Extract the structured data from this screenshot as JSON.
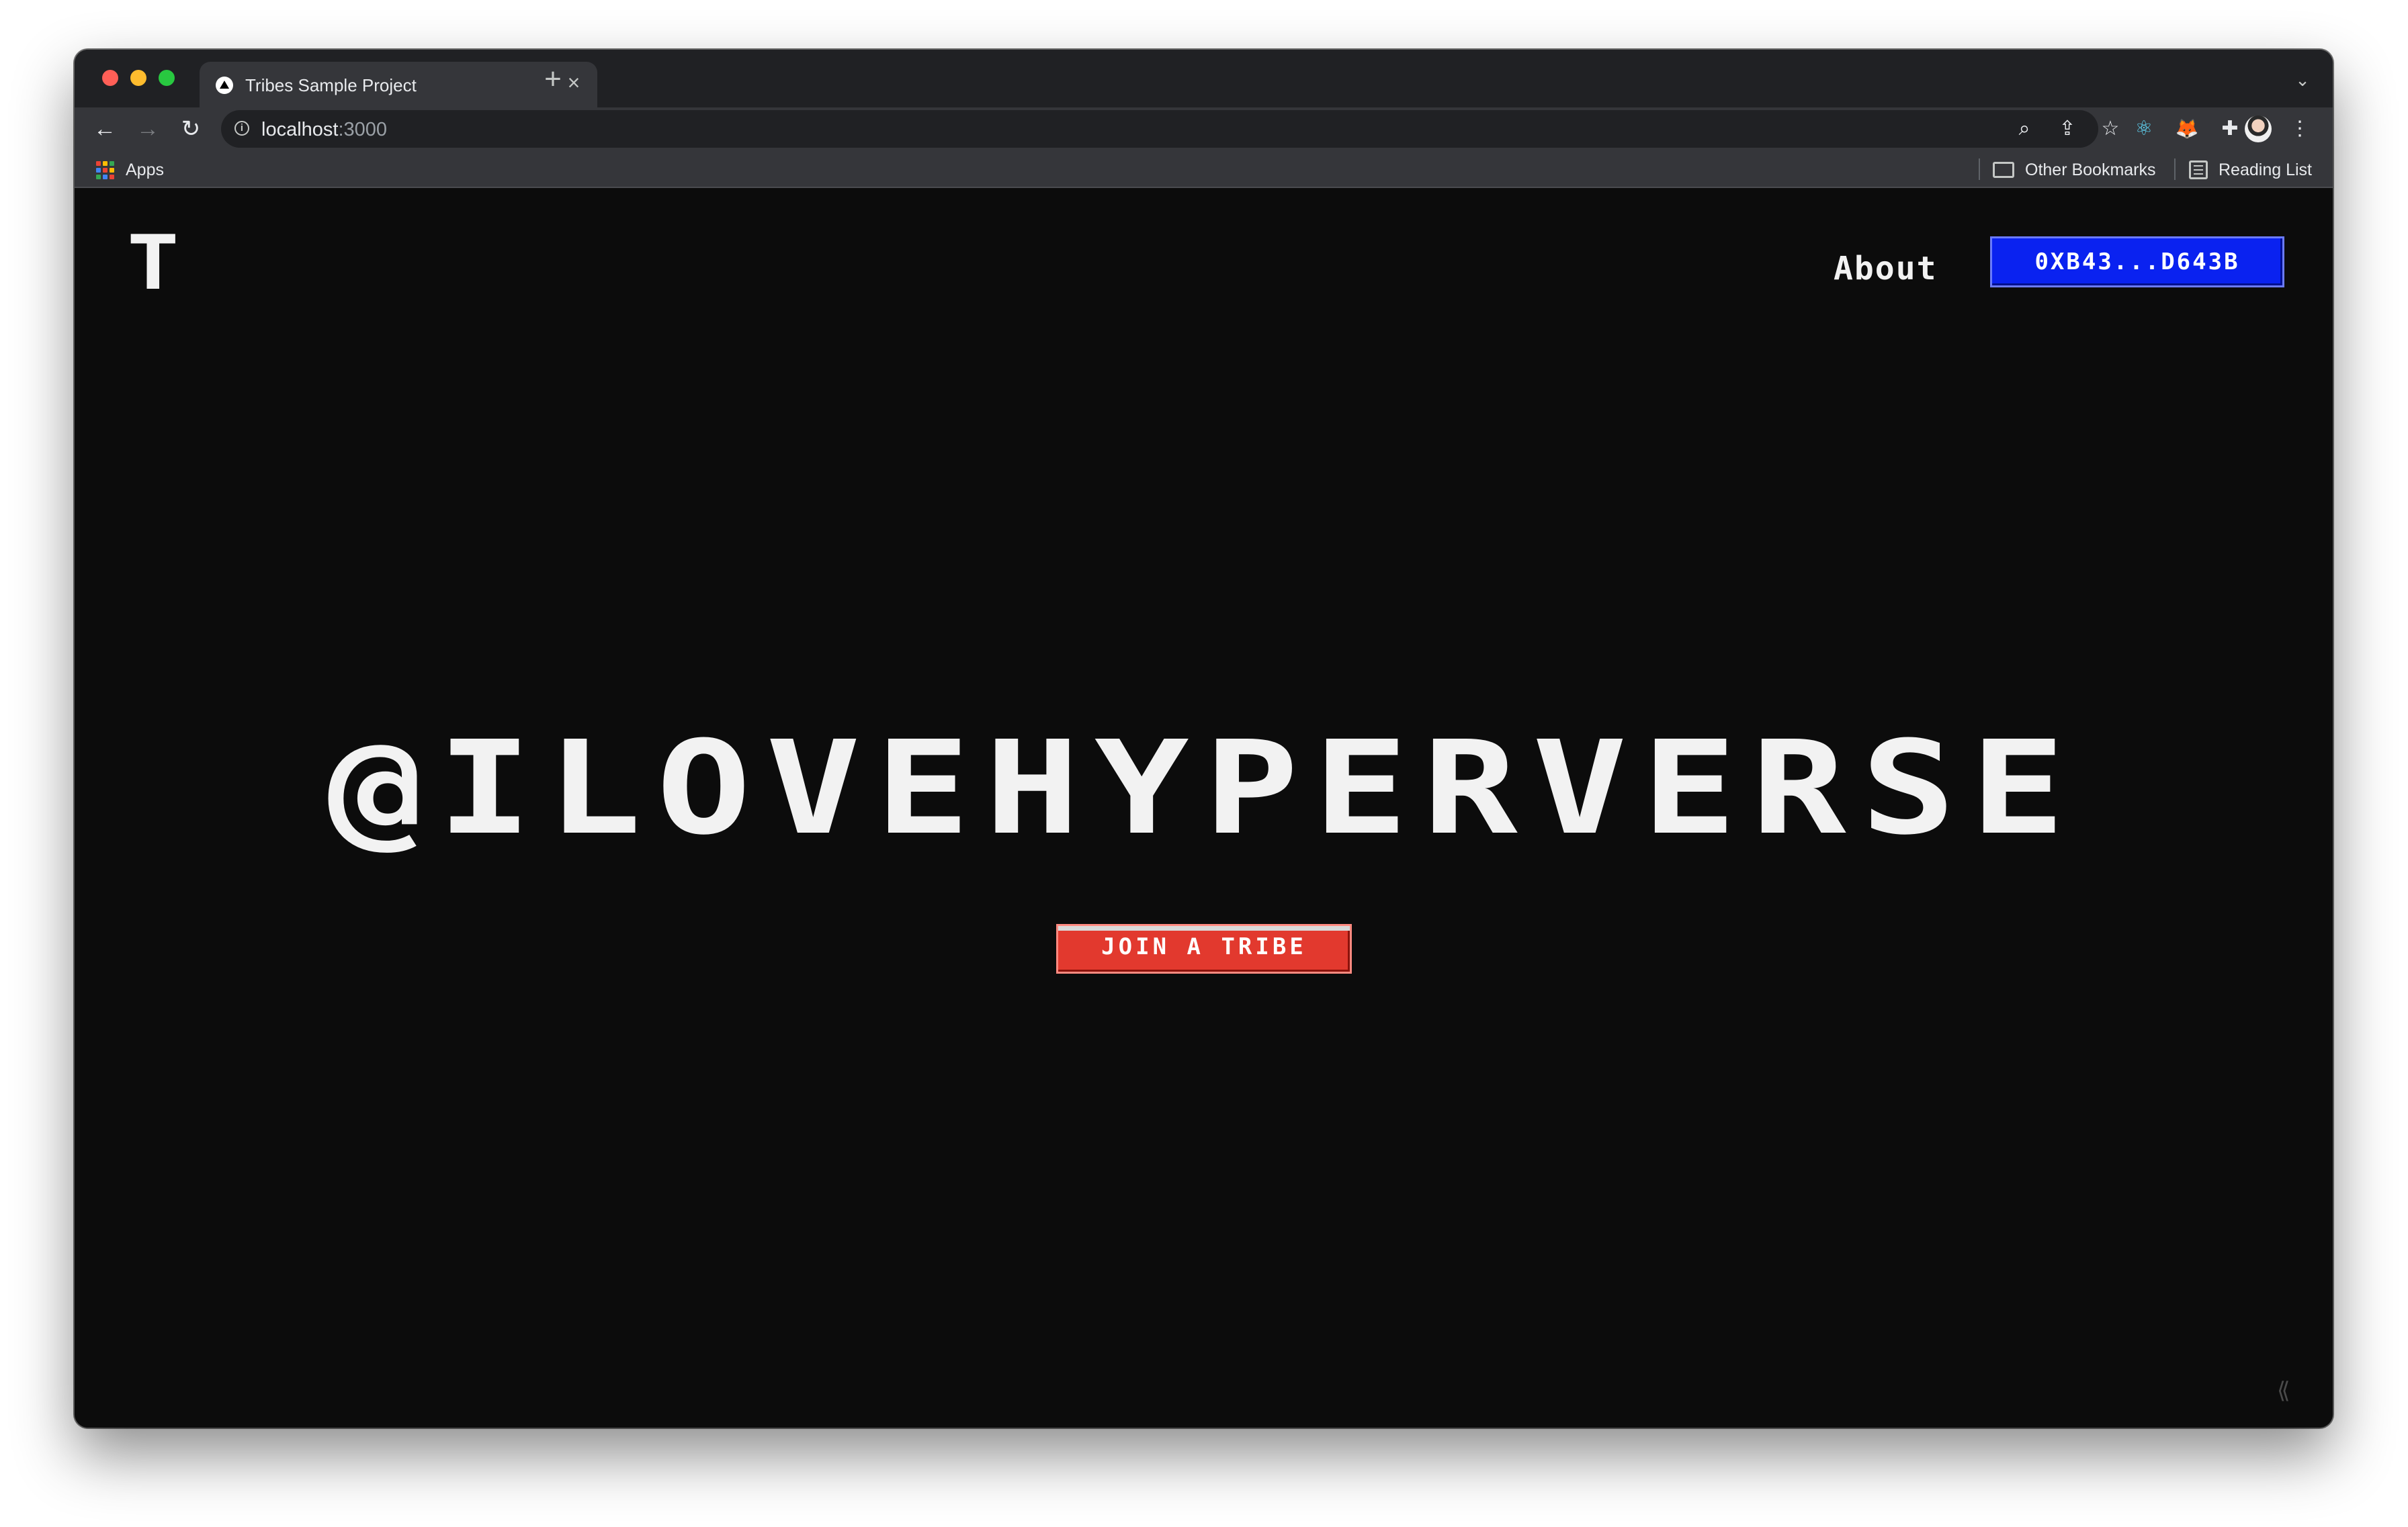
{
  "browser": {
    "tab": {
      "title": "Tribes Sample Project",
      "close_glyph": "×"
    },
    "new_tab_glyph": "+",
    "tabs_menu_glyph": "⌄",
    "nav": {
      "back_glyph": "←",
      "forward_glyph": "→",
      "reload_glyph": "↻"
    },
    "omnibox": {
      "host": "localhost",
      "port": ":3000",
      "info_glyph": "i"
    },
    "toolbar_icons": {
      "zoom_glyph": "⌕",
      "share_glyph": "⇪",
      "star_glyph": "☆",
      "react_glyph": "⚛",
      "metamask_glyph": "🦊",
      "extensions_glyph": "✚",
      "menu_glyph": "⋮"
    },
    "bookmarks": {
      "apps_label": "Apps",
      "apps_colors": [
        "#ea4335",
        "#fbbc04",
        "#34a853",
        "#4285f4",
        "#ea4335",
        "#fbbc04",
        "#34a853",
        "#4285f4",
        "#ea4335"
      ],
      "other_bookmarks_label": "Other Bookmarks",
      "reading_list_label": "Reading List"
    }
  },
  "page": {
    "logo": "T",
    "nav": {
      "about_label": "About"
    },
    "wallet_button_label": "0XB43...D643B",
    "hero_title": "@ILOVEHYPERVERSE",
    "cta_label": "JOIN A TRIBE",
    "corner_glyph": "⟪"
  },
  "colors": {
    "page_bg": "#0c0c0c",
    "wallet_button": "#0a22f0",
    "cta_button": "#e2392e",
    "text": "#f2f2f2"
  }
}
